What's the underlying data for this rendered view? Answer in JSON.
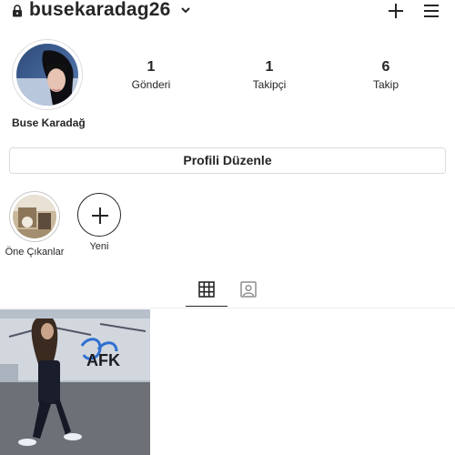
{
  "header": {
    "username": "busekaradag26",
    "lock_icon": "lock-icon",
    "chevron_icon": "chevron-down-icon",
    "new_post_icon": "plus-icon",
    "menu_icon": "hamburger-menu-icon"
  },
  "profile": {
    "display_name": "Buse Karadağ",
    "stats": [
      {
        "value": "1",
        "label": "Gönderi"
      },
      {
        "value": "1",
        "label": "Takipçi"
      },
      {
        "value": "6",
        "label": "Takip"
      }
    ],
    "edit_button_label": "Profili Düzenle"
  },
  "highlights": [
    {
      "label": "Öne Çıkanlar"
    },
    {
      "label": "Yeni"
    }
  ],
  "tabs": [
    {
      "icon": "grid-icon",
      "active": true
    },
    {
      "icon": "tagged-icon",
      "active": false
    }
  ],
  "posts": [
    {
      "wall_text": "AFK"
    }
  ],
  "colors": {
    "text": "#262626",
    "border": "#dbdbdb",
    "divider": "#efefef",
    "background": "#ffffff"
  }
}
